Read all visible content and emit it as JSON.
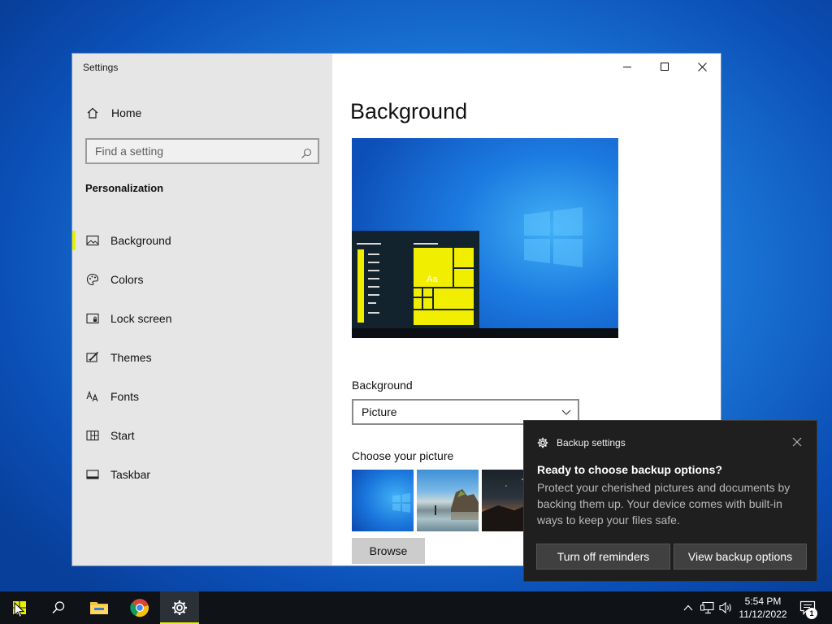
{
  "window": {
    "title": "Settings",
    "controls": {
      "minimize": "minimize",
      "maximize": "maximize",
      "close": "close"
    }
  },
  "sidebar": {
    "home_label": "Home",
    "search_placeholder": "Find a setting",
    "section_title": "Personalization",
    "items": [
      {
        "label": "Background",
        "icon": "picture-icon",
        "active": true
      },
      {
        "label": "Colors",
        "icon": "palette-icon",
        "active": false
      },
      {
        "label": "Lock screen",
        "icon": "lock-screen-icon",
        "active": false
      },
      {
        "label": "Themes",
        "icon": "themes-icon",
        "active": false
      },
      {
        "label": "Fonts",
        "icon": "fonts-icon",
        "active": false
      },
      {
        "label": "Start",
        "icon": "start-icon",
        "active": false
      },
      {
        "label": "Taskbar",
        "icon": "taskbar-icon",
        "active": false
      }
    ],
    "accent_color": "#e8f000"
  },
  "main": {
    "page_title": "Background",
    "preview_tile_text": "Aa",
    "background_label": "Background",
    "background_value": "Picture",
    "choose_label": "Choose your picture",
    "browse_label": "Browse"
  },
  "toast": {
    "app_name": "Backup settings",
    "title": "Ready to choose backup options?",
    "body": "Protect your cherished pictures and documents by backing them up. Your device comes with built-in ways to keep your files safe.",
    "button_turn_off": "Turn off reminders",
    "button_view": "View backup options"
  },
  "taskbar": {
    "time": "5:54 PM",
    "date": "11/12/2022",
    "notification_count": "1",
    "apps": [
      "start-icon",
      "search-icon",
      "file-explorer-icon",
      "chrome-icon",
      "settings-gear-icon"
    ]
  }
}
